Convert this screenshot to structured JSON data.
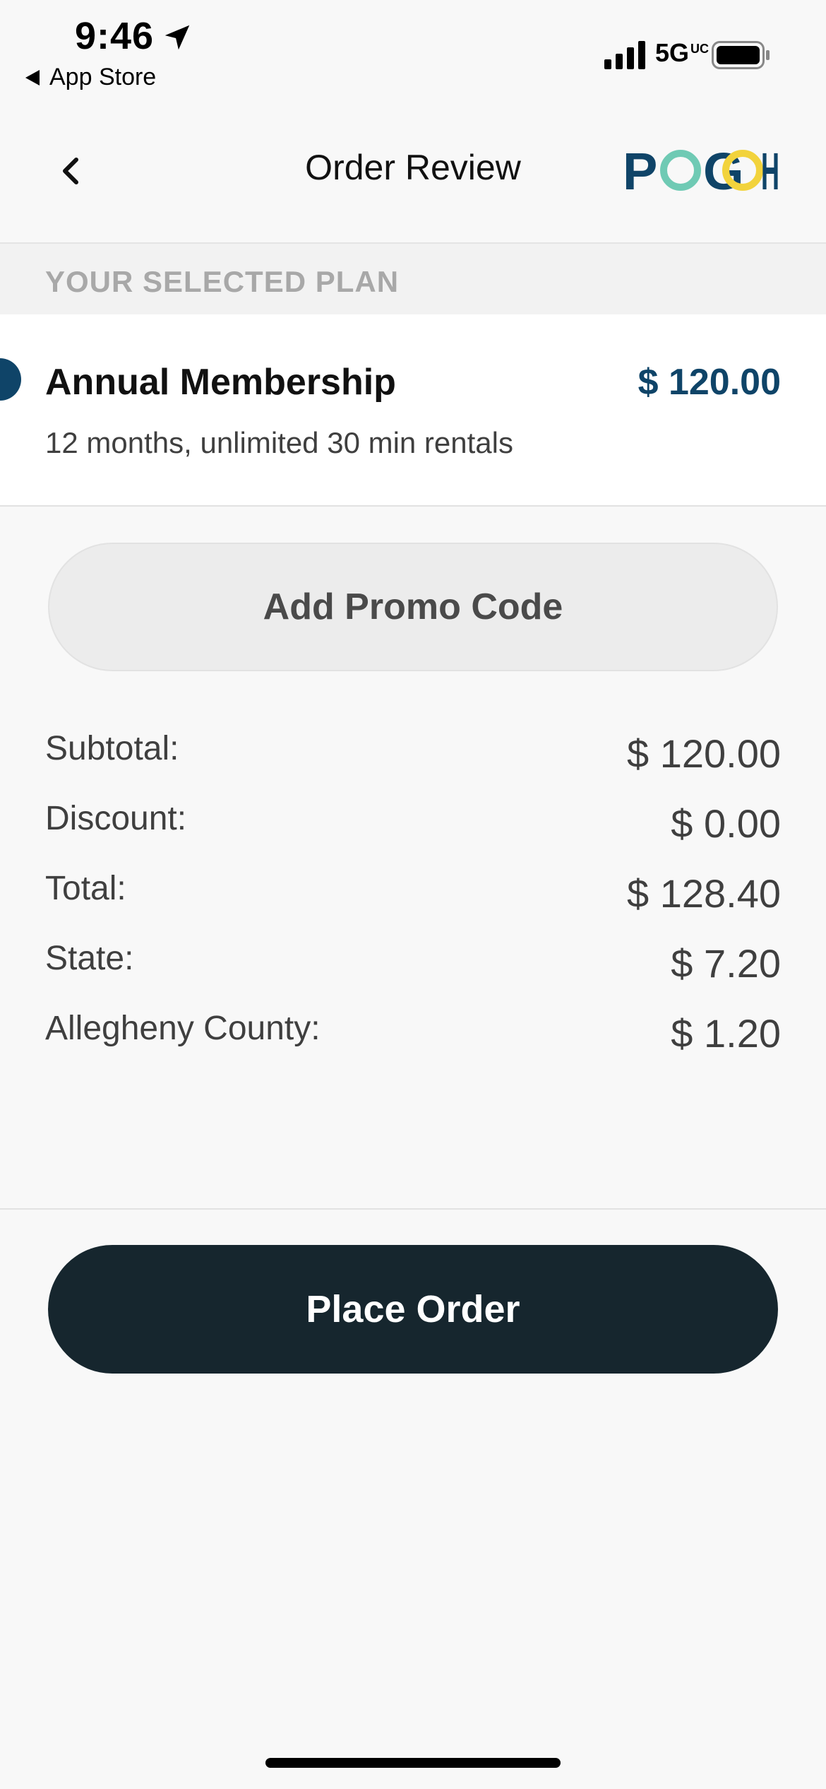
{
  "status_bar": {
    "time": "9:46",
    "back_app_label": "App Store",
    "network": "5G",
    "network_suffix": "UC"
  },
  "nav": {
    "title": "Order Review",
    "logo_text": "POGOH"
  },
  "plan_section": {
    "header": "YOUR SELECTED PLAN",
    "plan": {
      "name": "Annual Membership",
      "price": "$ 120.00",
      "description": "12 months, unlimited 30 min rentals"
    }
  },
  "promo": {
    "label": "Add Promo Code"
  },
  "summary": {
    "rows": [
      {
        "label": "Subtotal:",
        "value": "$ 120.00"
      },
      {
        "label": "Discount:",
        "value": "$ 0.00"
      },
      {
        "label": "Total:",
        "value": "$ 128.40"
      },
      {
        "label": "State:",
        "value": "$ 7.20"
      },
      {
        "label": "Allegheny County:",
        "value": "$ 1.20"
      }
    ]
  },
  "actions": {
    "place_order_label": "Place Order"
  },
  "colors": {
    "brand_blue": "#0f4468",
    "logo_teal": "#6fcab4",
    "logo_yellow": "#f2d33c",
    "button_dark": "#16262e"
  },
  "icons": {
    "location": "location-arrow-icon",
    "back": "chevron-left-icon",
    "signal": "cellular-signal-icon",
    "battery": "battery-icon"
  }
}
